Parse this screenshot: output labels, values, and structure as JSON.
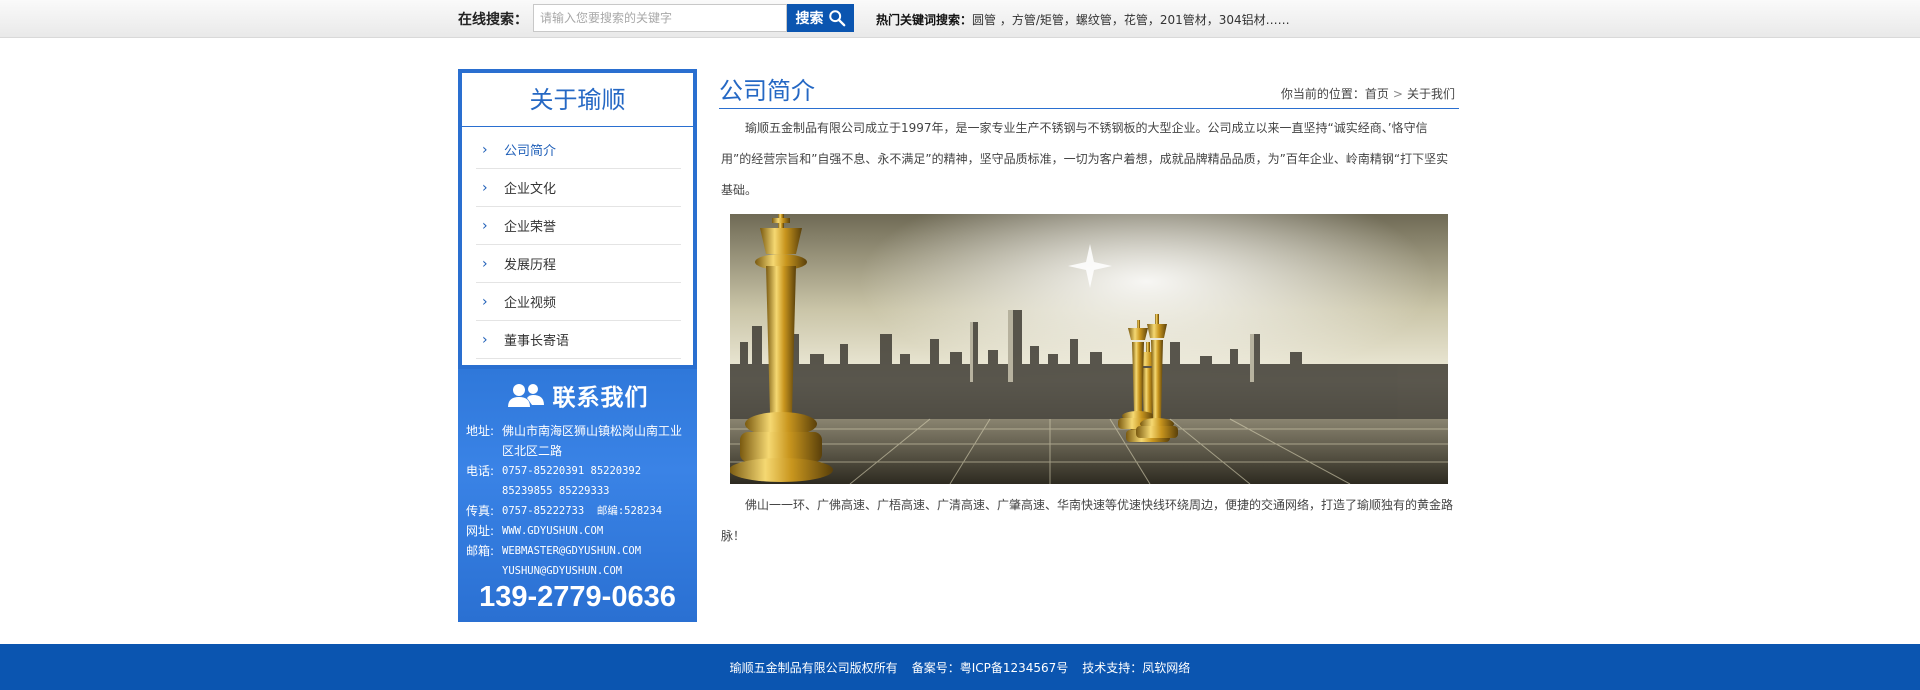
{
  "search": {
    "label": "在线搜索：",
    "placeholder": "请输入您要搜索的关键字",
    "button_label": "搜索",
    "hot_label": "热门关键词搜索：",
    "hot_terms": "圆管 ，方管/矩管，螺纹管，花管，201管材，304铝材……"
  },
  "sidebar": {
    "about_title": "关于瑜顺",
    "items": [
      {
        "label": "公司简介",
        "active": true
      },
      {
        "label": "企业文化"
      },
      {
        "label": "企业荣誉"
      },
      {
        "label": "发展历程"
      },
      {
        "label": "企业视频"
      },
      {
        "label": "董事长寄语"
      }
    ],
    "contact": {
      "title": "联系我们",
      "address_key": "地址:",
      "address": "佛山市南海区狮山镇松岗山南工业区北区二路",
      "phone_key": "电话:",
      "phone_line1": "0757-85220391  85220392",
      "phone_line2": "85239855  85229333",
      "fax_key": "传真:",
      "fax": "0757-85222733",
      "zip_key": "邮编:",
      "zip": "528234",
      "web_key": "网址:",
      "web": "WWW.GDYUSHUN.COM",
      "mail_key": "邮箱:",
      "mail1": "WEBMASTER@GDYUSHUN.COM",
      "mail2": "YUSHUN@GDYUSHUN.COM",
      "hotline": "139-2779-0636"
    }
  },
  "main": {
    "title": "公司简介",
    "crumb_prefix": "你当前的位置：",
    "crumb_home": "首页",
    "crumb_current": "关于我们",
    "para1": "瑜顺五金制品有限公司成立于1997年，是一家专业生产不锈钢与不锈钢板的大型企业。公司成立以来一直坚持“诚实经商、’恪守信用”的经营宗旨和”自强不息、永不满足”的精神，坚守品质标准，一切为客户着想，成就品牌精品品质，为”百年企业、岭南精钢“打下坚实基础。",
    "para2": "佛山一一环、广佛高速、广梧高速、广清高速、广肇高速、华南快速等优速快线环绕周边，便捷的交通网络，打造了瑜顺独有的黄金路脉！"
  },
  "footer": {
    "copyright": "瑜顺五金制品有限公司版权所有",
    "icp": "备案号：粤ICP备1234567号",
    "support": "技术支持：凤软网络"
  },
  "colors": {
    "brand_blue": "#0b55b0",
    "accent_blue": "#2568c4"
  }
}
